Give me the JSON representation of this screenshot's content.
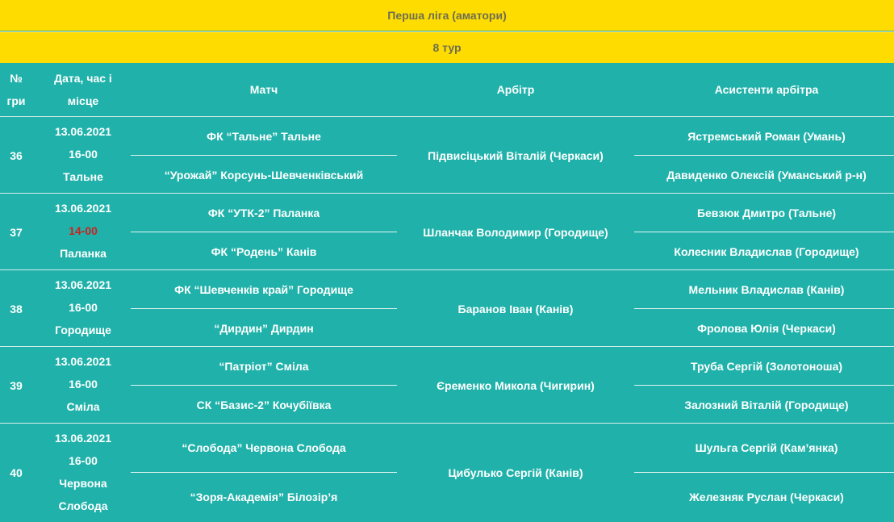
{
  "title": "Перша ліга (аматори)",
  "round": "8 тур",
  "columns": {
    "num": "№ гри",
    "date": "Дата, час і місце",
    "match": "Матч",
    "referee": "Арбітр",
    "assistants": "Асистенти арбітра"
  },
  "games": [
    {
      "num": "36",
      "date": "13.06.2021",
      "time": "16-00",
      "place": "Тальне",
      "home": "ФК “Тальне” Тальне",
      "away": "“Урожай” Корсунь-Шевченківський",
      "referee": "Підвисіцький Віталій (Черкаси)",
      "assistant1": "Ястремський Роман (Умань)",
      "assistant2": "Давиденко Олексій (Уманський р-н)"
    },
    {
      "num": "37",
      "date": "13.06.2021",
      "time": "14-00",
      "place": "Паланка",
      "home": "ФК “УТК-2” Паланка",
      "away": "ФК “Родень” Канів",
      "referee": "Шланчак Володимир (Городище)",
      "assistant1": "Бевзюк Дмитро (Тальне)",
      "assistant2": "Колесник Владислав (Городище)"
    },
    {
      "num": "38",
      "date": "13.06.2021",
      "time": "16-00",
      "place": "Городище",
      "home": "ФК “Шевченків край” Городище",
      "away": "“Дирдин” Дирдин",
      "referee": "Баранов Іван (Канів)",
      "assistant1": "Мельник Владислав (Канів)",
      "assistant2": "Фролова Юлія (Черкаси)"
    },
    {
      "num": "39",
      "date": "13.06.2021",
      "time": "16-00",
      "place": "Сміла",
      "home": "“Патріот” Сміла",
      "away": "СК “Базис-2” Кочубіївка",
      "referee": "Єременко Микола (Чигирин)",
      "assistant1": "Труба Сергій (Золотоноша)",
      "assistant2": "Залозний Віталій (Городище)"
    },
    {
      "num": "40",
      "date": "13.06.2021",
      "time": "16-00",
      "place": "Червона Слобода",
      "home": "“Слобода” Червона Слобода",
      "away": "“Зоря-Академія” Білозір’я",
      "referee": "Цибулько Сергій (Канів)",
      "assistant1": "Шульга Сергій (Кам’янка)",
      "assistant2": "Железняк Руслан (Черкаси)"
    }
  ],
  "colors": {
    "band": "#fedc00",
    "table": "#20b2aa",
    "highlight": "#c8231f"
  }
}
